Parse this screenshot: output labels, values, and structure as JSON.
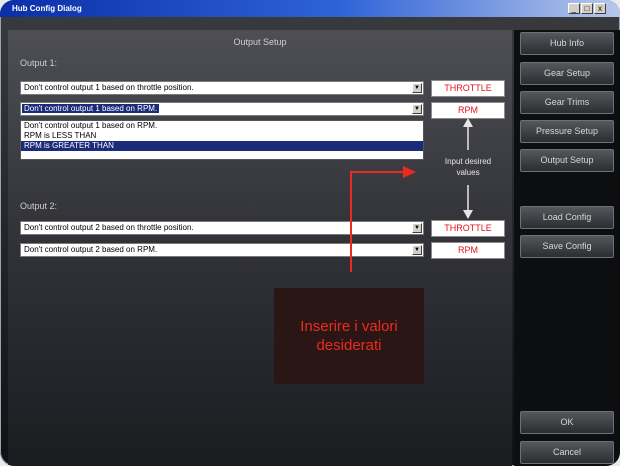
{
  "window": {
    "title": "Hub Config Dialog",
    "controls": [
      "_",
      "□",
      "x"
    ]
  },
  "main": {
    "header": "Output Setup",
    "output1": {
      "label": "Output 1:",
      "throttle_value": "Don't control output 1 based on throttle position.",
      "rpm_value": "Don't control output 1 based on RPM.",
      "throttle_box": "THROTTLE",
      "rpm_box": "RPM",
      "rpm_options": [
        "Don't control output 1 based on RPM.",
        "RPM is LESS THAN",
        "RPM is GREATER THAN"
      ],
      "rpm_highlighted_option": "RPM is GREATER THAN"
    },
    "output2": {
      "label": "Output 2:",
      "throttle_value": "Don't control output 2 based on throttle position.",
      "rpm_value": "Don't control output 2 based on RPM.",
      "throttle_box": "THROTTLE",
      "rpm_box": "RPM"
    },
    "hint": "Input desired values",
    "callout": "Inserire i valori desiderati"
  },
  "sidebar": {
    "hub_info": "Hub Info",
    "gear_setup": "Gear Setup",
    "gear_trims": "Gear Trims",
    "pressure_setup": "Pressure Setup",
    "output_setup": "Output Setup",
    "load_config": "Load Config",
    "save_config": "Save Config",
    "ok": "OK",
    "cancel": "Cancel"
  },
  "colors": {
    "accent_red": "#e5121f",
    "selection_blue": "#1a2b7a",
    "titlebar_blue": "#0b2fa8"
  },
  "icons": {
    "combo_arrow": "chevron-down-icon",
    "arrow_up": "arrow-up-icon",
    "arrow_down": "arrow-down-icon",
    "callout_arrow": "arrow-right-icon"
  }
}
